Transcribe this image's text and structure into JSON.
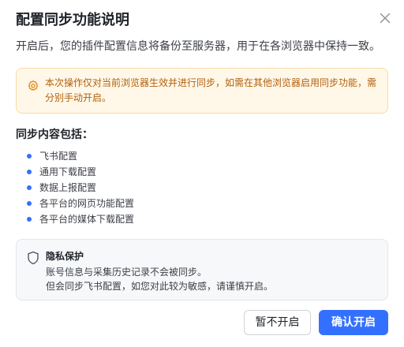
{
  "dialog": {
    "title": "配置同步功能说明",
    "description": "开启后，您的插件配置信息将备份至服务器，用于在各浏览器中保持一致。",
    "close_icon": "close-icon"
  },
  "warning": {
    "icon": "gear-icon",
    "text": "本次操作仅对当前浏览器生效并进行同步，如需在其他浏览器启用同步功能，需分别手动开启。"
  },
  "sync_content": {
    "heading": "同步内容包括：",
    "items": [
      "飞书配置",
      "通用下载配置",
      "数据上报配置",
      "各平台的网页功能配置",
      "各平台的媒体下载配置"
    ]
  },
  "privacy": {
    "icon": "shield-icon",
    "title": "隐私保护",
    "line1": "账号信息与采集历史记录不会被同步。",
    "line2": "但会同步飞书配置，如您对此较为敏感，请谨慎开启。"
  },
  "buttons": {
    "cancel": "暂不开启",
    "confirm": "确认开启"
  },
  "colors": {
    "primary": "#3370ff",
    "warning_bg": "#fff8e8",
    "warning_border": "#f7dca4",
    "warning_text": "#b25f0c",
    "privacy_bg": "#f7f8fa"
  }
}
